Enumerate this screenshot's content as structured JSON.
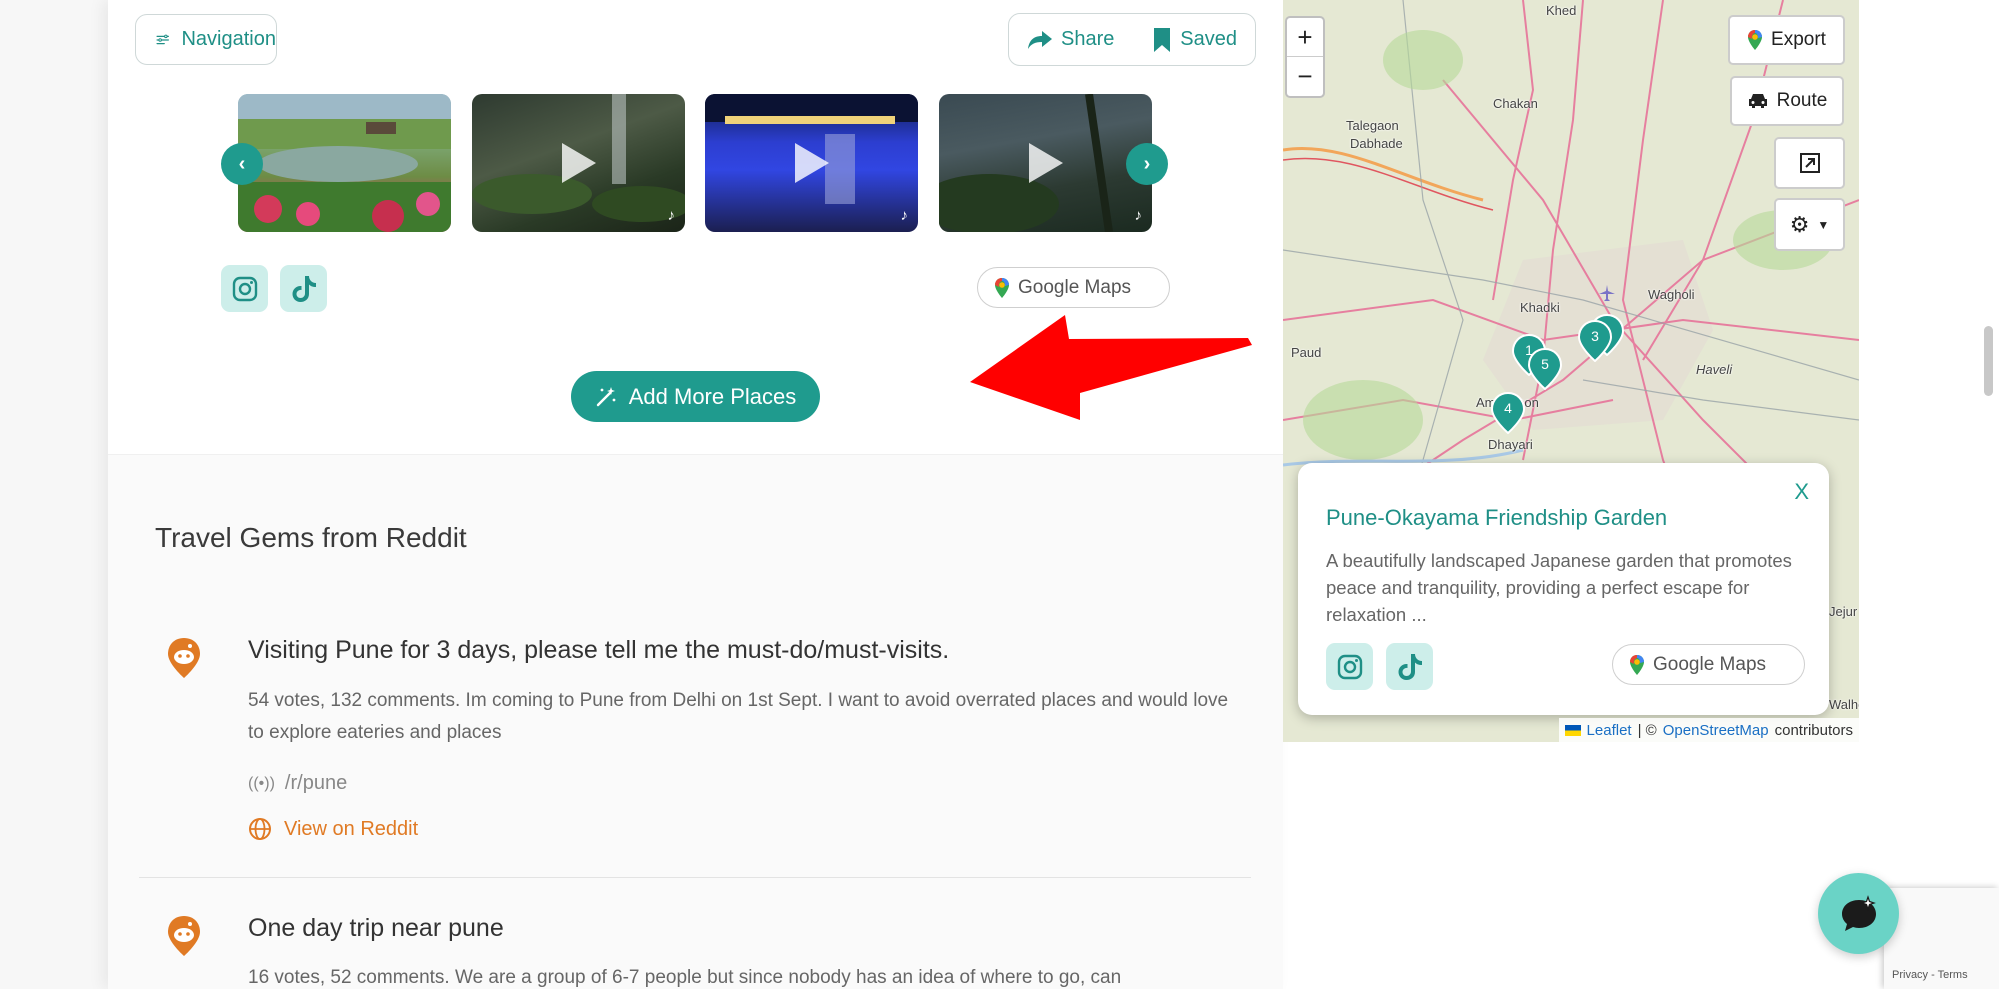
{
  "toolbar": {
    "navigation_label": "Navigation",
    "share_label": "Share",
    "saved_label": "Saved"
  },
  "carousel": {
    "items": [
      {
        "kind": "image",
        "icon": "photo"
      },
      {
        "kind": "video",
        "icon": "play-icon",
        "source": "tiktok-icon"
      },
      {
        "kind": "video",
        "icon": "play-icon",
        "source": "tiktok-icon"
      },
      {
        "kind": "video",
        "icon": "play-icon",
        "source": "tiktok-icon"
      }
    ]
  },
  "links": {
    "google_maps_label": "Google Maps"
  },
  "actions": {
    "add_more_label": "Add More Places"
  },
  "reddit": {
    "section_title": "Travel Gems from Reddit",
    "posts": [
      {
        "title": "Visiting Pune for 3 days, please tell me the must-do/must-visits.",
        "body": "54 votes, 132 comments. Im coming to Pune from Delhi on 1st Sept. I want to avoid overrated places and would love to explore eateries and places",
        "subreddit": "/r/pune",
        "link_label": "View on Reddit"
      },
      {
        "title": "One day trip near pune",
        "body": "16 votes, 52 comments. We are a group of 6-7 people but since nobody has an idea of where to go, can"
      }
    ]
  },
  "map": {
    "zoom_in": "+",
    "zoom_out": "−",
    "export_label": "Export",
    "route_label": "Route",
    "labels": {
      "khed": "Khed",
      "chakan": "Chakan",
      "talegaon": "Talegaon",
      "dabhade": "Dabhade",
      "paud": "Paud",
      "khadki": "Khadki",
      "wagholi": "Wagholi",
      "havell": "Haveli",
      "ambegaon": "Ambegaon",
      "dhayari": "Dhayari",
      "jejur": "Jejur",
      "walhe": "Walhe"
    },
    "markers": [
      "1",
      "3",
      "5",
      "4"
    ],
    "popup": {
      "close": "X",
      "title": "Pune-Okayama Friendship Garden",
      "description": "A beautifully landscaped Japanese garden that promotes peace and tranquility, providing a perfect escape for relaxation ...",
      "google_maps_label": "Google Maps"
    },
    "attribution": {
      "leaflet": "Leaflet",
      "separator": "| ©",
      "osm": "OpenStreetMap",
      "contributors": "contributors"
    }
  },
  "recaptcha": {
    "terms": "Privacy - Terms"
  },
  "colors": {
    "accent": "#1f9b8e",
    "accent_text": "#1f8f86",
    "reddit_orange": "#e07a24",
    "annotation_red": "#ff0000"
  }
}
